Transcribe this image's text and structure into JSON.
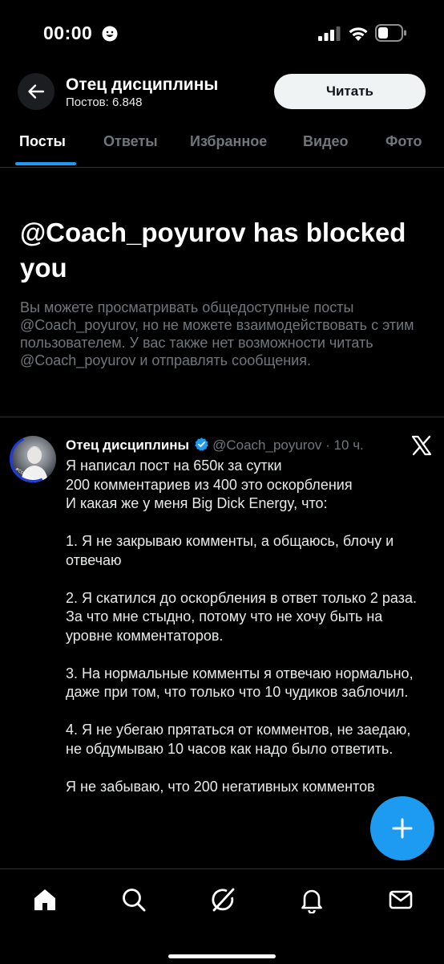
{
  "status_bar": {
    "time": "00:00"
  },
  "header": {
    "title": "Отец дисциплины",
    "subtitle": "Постов: 6.848",
    "follow_label": "Читать"
  },
  "tabs": [
    {
      "label": "Посты",
      "active": true
    },
    {
      "label": "Ответы"
    },
    {
      "label": "Избранное"
    },
    {
      "label": "Видео"
    },
    {
      "label": "Фото"
    }
  ],
  "blocked": {
    "title": "@Coach_poyurov has blocked you",
    "text": "Вы можете просматривать общедоступные посты @Coach_poyurov, но не можете взаимодействовать с этим пользователем. У вас также нет возможности читать @Coach_poyurov и отправлять сообщения."
  },
  "post": {
    "name": "Отец дисциплины",
    "verified": true,
    "handle": "@Coach_poyurov",
    "time": "· 10 ч.",
    "avatar_text": "#COACHING",
    "lines": [
      "Я написал пост на 650к за сутки",
      "200 комментариев из 400 это оскорбления",
      "И какая же у меня Big Dick Energy, что:",
      "",
      "1. Я не закрываю комменты, а общаюсь, блочу и отвечаю",
      "",
      "2. Я скатился до оскорбления в ответ только 2 раза. За что мне стыдно, потому что не хочу быть на уровне комментаторов.",
      "",
      "3. На нормальные комменты я отвечаю нормально, даже при том, что только что 10 чудиков заблочил.",
      "",
      "4. Я не убегаю прятаться от комментов, не заедаю, не обдумываю 10 часов как надо было ответить.",
      "",
      "Я не забываю, что 200 негативных комментов"
    ]
  },
  "colors": {
    "accent": "#1d9bf0",
    "background": "#000000",
    "muted": "#71767b"
  },
  "icons": {
    "nav": [
      "home-icon",
      "search-icon",
      "grok-icon",
      "notifications-icon",
      "messages-icon"
    ],
    "fab": "compose-plus-icon"
  }
}
